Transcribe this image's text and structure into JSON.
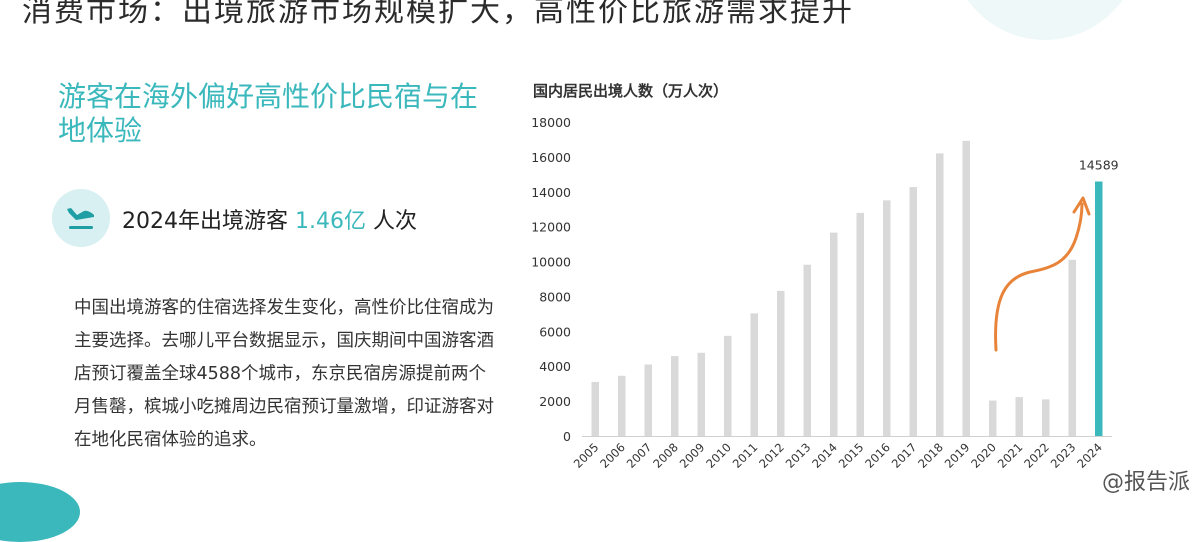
{
  "header": {
    "title": "消费市场：出境旅游市场规模扩大，高性价比旅游需求提升"
  },
  "section": {
    "title": "游客在海外偏好高性价比民宿与在地体验",
    "stat_prefix": "2024年出境游客",
    "stat_value": "1.46亿",
    "stat_suffix": "人次",
    "stat_icon": "airplane-landing-icon",
    "body": "中国出境游客的住宿选择发生变化，高性价比住宿成为主要选择。去哪儿平台数据显示，国庆期间中国游客酒店预订覆盖全球4588个城市，东京民宿房源提前两个月售罄，槟城小吃摊周边民宿预订量激增，印证游客对在地化民宿体验的追求。"
  },
  "watermark": "@报告派",
  "colors": {
    "accent": "#3bb8bc",
    "bar": "#d9d9d9",
    "bar_highlight": "#3bb8bc",
    "arrow": "#e8843a"
  },
  "chart_data": {
    "type": "bar",
    "title": "国内居民出境人数（万人次）",
    "categories": [
      "2005",
      "2006",
      "2007",
      "2008",
      "2009",
      "2010",
      "2011",
      "2012",
      "2013",
      "2014",
      "2015",
      "2016",
      "2017",
      "2018",
      "2019",
      "2020",
      "2021",
      "2022",
      "2023",
      "2024"
    ],
    "values": [
      3100,
      3450,
      4100,
      4580,
      4770,
      5740,
      7030,
      8320,
      9820,
      11660,
      12790,
      13510,
      14270,
      16200,
      16920,
      2030,
      2230,
      2100,
      10100,
      14589
    ],
    "highlight_index": 19,
    "highlight_label": "14589",
    "ylim": [
      0,
      18000
    ],
    "yticks": [
      0,
      2000,
      4000,
      6000,
      8000,
      10000,
      12000,
      14000,
      16000,
      18000
    ],
    "grid": false,
    "annotation": "orange-upward-arrow"
  }
}
